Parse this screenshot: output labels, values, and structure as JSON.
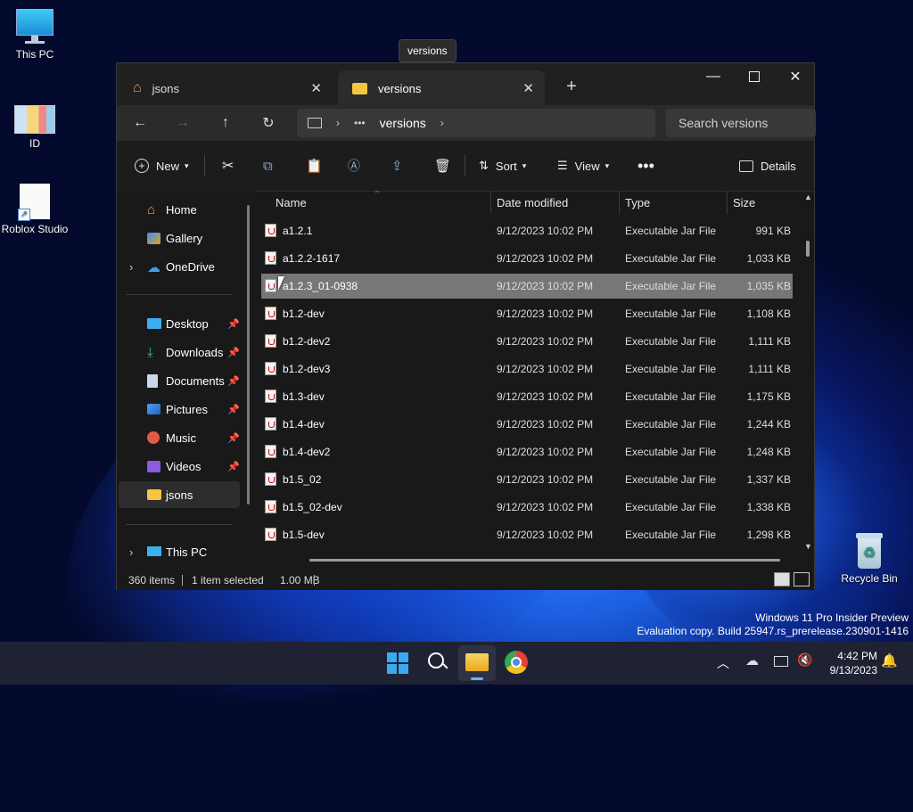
{
  "desktop": {
    "icons": [
      {
        "label": "This PC"
      },
      {
        "label": "ID"
      },
      {
        "label": "Roblox Studio"
      },
      {
        "label": "Recycle Bin"
      }
    ],
    "watermark_line1": "Windows 11 Pro Insider Preview",
    "watermark_line2": "Evaluation copy. Build 25947.rs_prerelease.230901-1416"
  },
  "tooltip": "versions",
  "window": {
    "tabs": [
      {
        "label": "jsons",
        "icon": "home-icon"
      },
      {
        "label": "versions",
        "icon": "folder-icon"
      }
    ],
    "address": {
      "crumb": "versions"
    },
    "search_placeholder": "Search versions",
    "commands": {
      "new": "New",
      "sort": "Sort",
      "view": "View",
      "details": "Details"
    },
    "sidebar": {
      "top": [
        {
          "label": "Home"
        },
        {
          "label": "Gallery"
        },
        {
          "label": "OneDrive"
        }
      ],
      "pinned": [
        {
          "label": "Desktop"
        },
        {
          "label": "Downloads"
        },
        {
          "label": "Documents"
        },
        {
          "label": "Pictures"
        },
        {
          "label": "Music"
        },
        {
          "label": "Videos"
        },
        {
          "label": "jsons"
        }
      ],
      "bottom": [
        {
          "label": "This PC"
        }
      ]
    },
    "columns": {
      "name": "Name",
      "date": "Date modified",
      "type": "Type",
      "size": "Size"
    },
    "files": [
      {
        "name": "a1.2.1",
        "date": "9/12/2023 10:02 PM",
        "type": "Executable Jar File",
        "size": "991 KB"
      },
      {
        "name": "a1.2.2-1617",
        "date": "9/12/2023 10:02 PM",
        "type": "Executable Jar File",
        "size": "1,033 KB"
      },
      {
        "name": "a1.2.3_01-0938",
        "date": "9/12/2023 10:02 PM",
        "type": "Executable Jar File",
        "size": "1,035 KB"
      },
      {
        "name": "b1.2-dev",
        "date": "9/12/2023 10:02 PM",
        "type": "Executable Jar File",
        "size": "1,108 KB"
      },
      {
        "name": "b1.2-dev2",
        "date": "9/12/2023 10:02 PM",
        "type": "Executable Jar File",
        "size": "1,111 KB"
      },
      {
        "name": "b1.2-dev3",
        "date": "9/12/2023 10:02 PM",
        "type": "Executable Jar File",
        "size": "1,111 KB"
      },
      {
        "name": "b1.3-dev",
        "date": "9/12/2023 10:02 PM",
        "type": "Executable Jar File",
        "size": "1,175 KB"
      },
      {
        "name": "b1.4-dev",
        "date": "9/12/2023 10:02 PM",
        "type": "Executable Jar File",
        "size": "1,244 KB"
      },
      {
        "name": "b1.4-dev2",
        "date": "9/12/2023 10:02 PM",
        "type": "Executable Jar File",
        "size": "1,248 KB"
      },
      {
        "name": "b1.5_02",
        "date": "9/12/2023 10:02 PM",
        "type": "Executable Jar File",
        "size": "1,337 KB"
      },
      {
        "name": "b1.5_02-dev",
        "date": "9/12/2023 10:02 PM",
        "type": "Executable Jar File",
        "size": "1,338 KB"
      },
      {
        "name": "b1.5-dev",
        "date": "9/12/2023 10:02 PM",
        "type": "Executable Jar File",
        "size": "1,298 KB"
      }
    ],
    "status": {
      "count": "360 items",
      "selection": "1 item selected",
      "size": "1.00 MB"
    }
  },
  "taskbar": {
    "time": "4:42 PM",
    "date": "9/13/2023"
  }
}
